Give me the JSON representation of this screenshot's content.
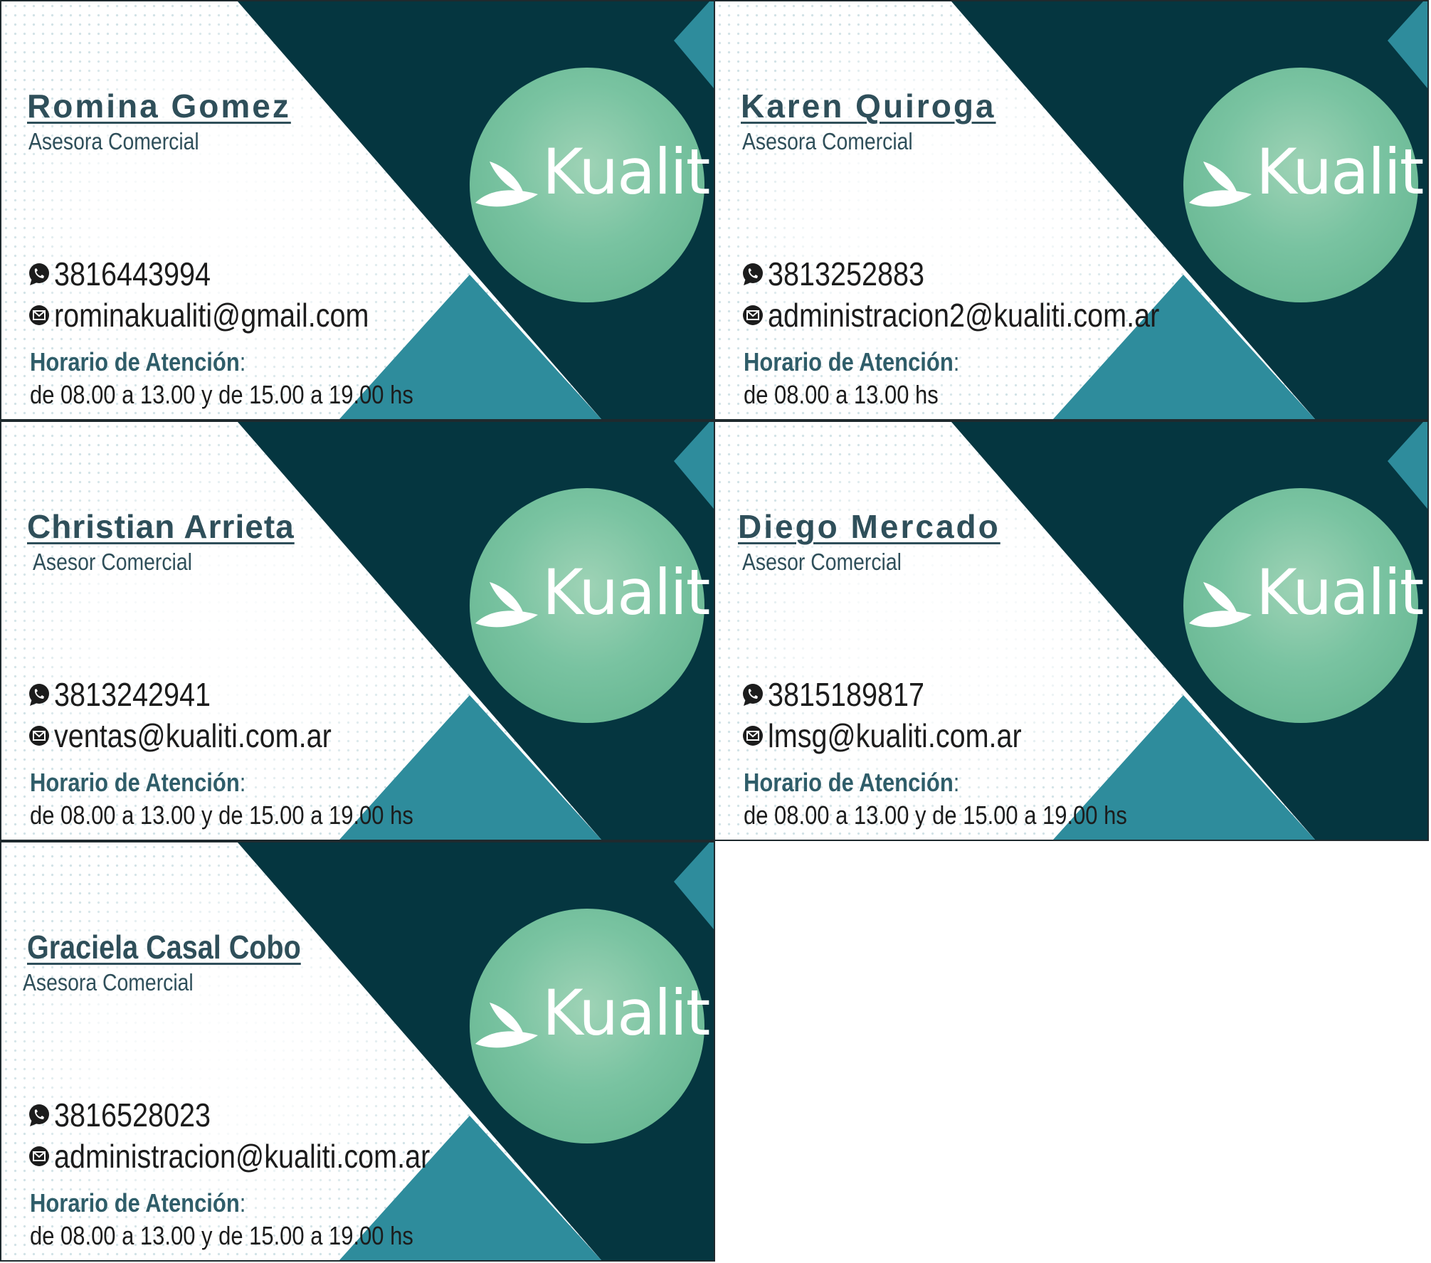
{
  "brand": {
    "logo_text": "Kualiti",
    "colors": {
      "dark_teal": "#053640",
      "mid_teal": "#2e8c9c",
      "logo_green": "#79c3a1",
      "name_color": "#2f4f5a",
      "label_color": "#2f5d69"
    }
  },
  "hours_label": "Horario de Atención",
  "cards": [
    {
      "name": "Romina Gomez",
      "role": "Asesora Comercial",
      "phone": "3816443994",
      "email": "rominakualiti@gmail.com",
      "hours": "de 08.00 a 13.00 y de 15.00 a 19.00 hs"
    },
    {
      "name": "Karen Quiroga",
      "role": "Asesora Comercial",
      "phone": "3813252883",
      "email": "administracion2@kualiti.com.ar",
      "hours": "de 08.00 a 13.00 hs"
    },
    {
      "name": "Christian Arrieta",
      "role": "Asesor Comercial",
      "phone": "3813242941",
      "email": "ventas@kualiti.com.ar",
      "hours": "de 08.00 a 13.00 y de 15.00 a 19.00 hs"
    },
    {
      "name": "Diego Mercado",
      "role": "Asesor Comercial",
      "phone": "3815189817",
      "email": "lmsg@kualiti.com.ar",
      "hours": "de 08.00 a 13.00 y de 15.00 a 19.00 hs"
    },
    {
      "name": "Graciela Casal Cobo",
      "role": "Asesora Comercial",
      "phone": "3816528023",
      "email": "administracion@kualiti.com.ar",
      "hours": "de 08.00 a 13.00 y de 15.00 a 19.00 hs"
    }
  ]
}
